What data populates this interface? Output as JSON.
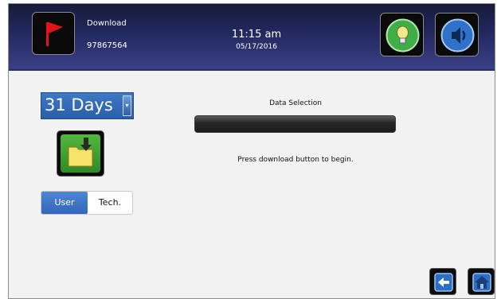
{
  "header": {
    "title": "Download",
    "device_id": "97867564",
    "time": "11:15 am",
    "date": "05/17/2016",
    "icons": {
      "flag": "red-flag-icon",
      "bulb": "lightbulb-icon",
      "sound": "speaker-icon"
    }
  },
  "left_panel": {
    "days_select": {
      "value": "31 Days",
      "arrow": "▾"
    },
    "download_icon": "folder-download-icon",
    "toggle": {
      "user_label": "User",
      "tech_label": "Tech.",
      "selected": "User"
    }
  },
  "main": {
    "data_selection_label": "Data Selection",
    "progress": 0,
    "status": "Press download button to begin."
  },
  "footer": {
    "back_icon": "back-arrow-icon",
    "home_icon": "home-icon"
  },
  "colors": {
    "header_dark": "#171b3a",
    "header_light": "#3a3f87",
    "accent_blue": "#3266b8",
    "download_green": "#3fa52f",
    "flag_red": "#e0151b"
  }
}
